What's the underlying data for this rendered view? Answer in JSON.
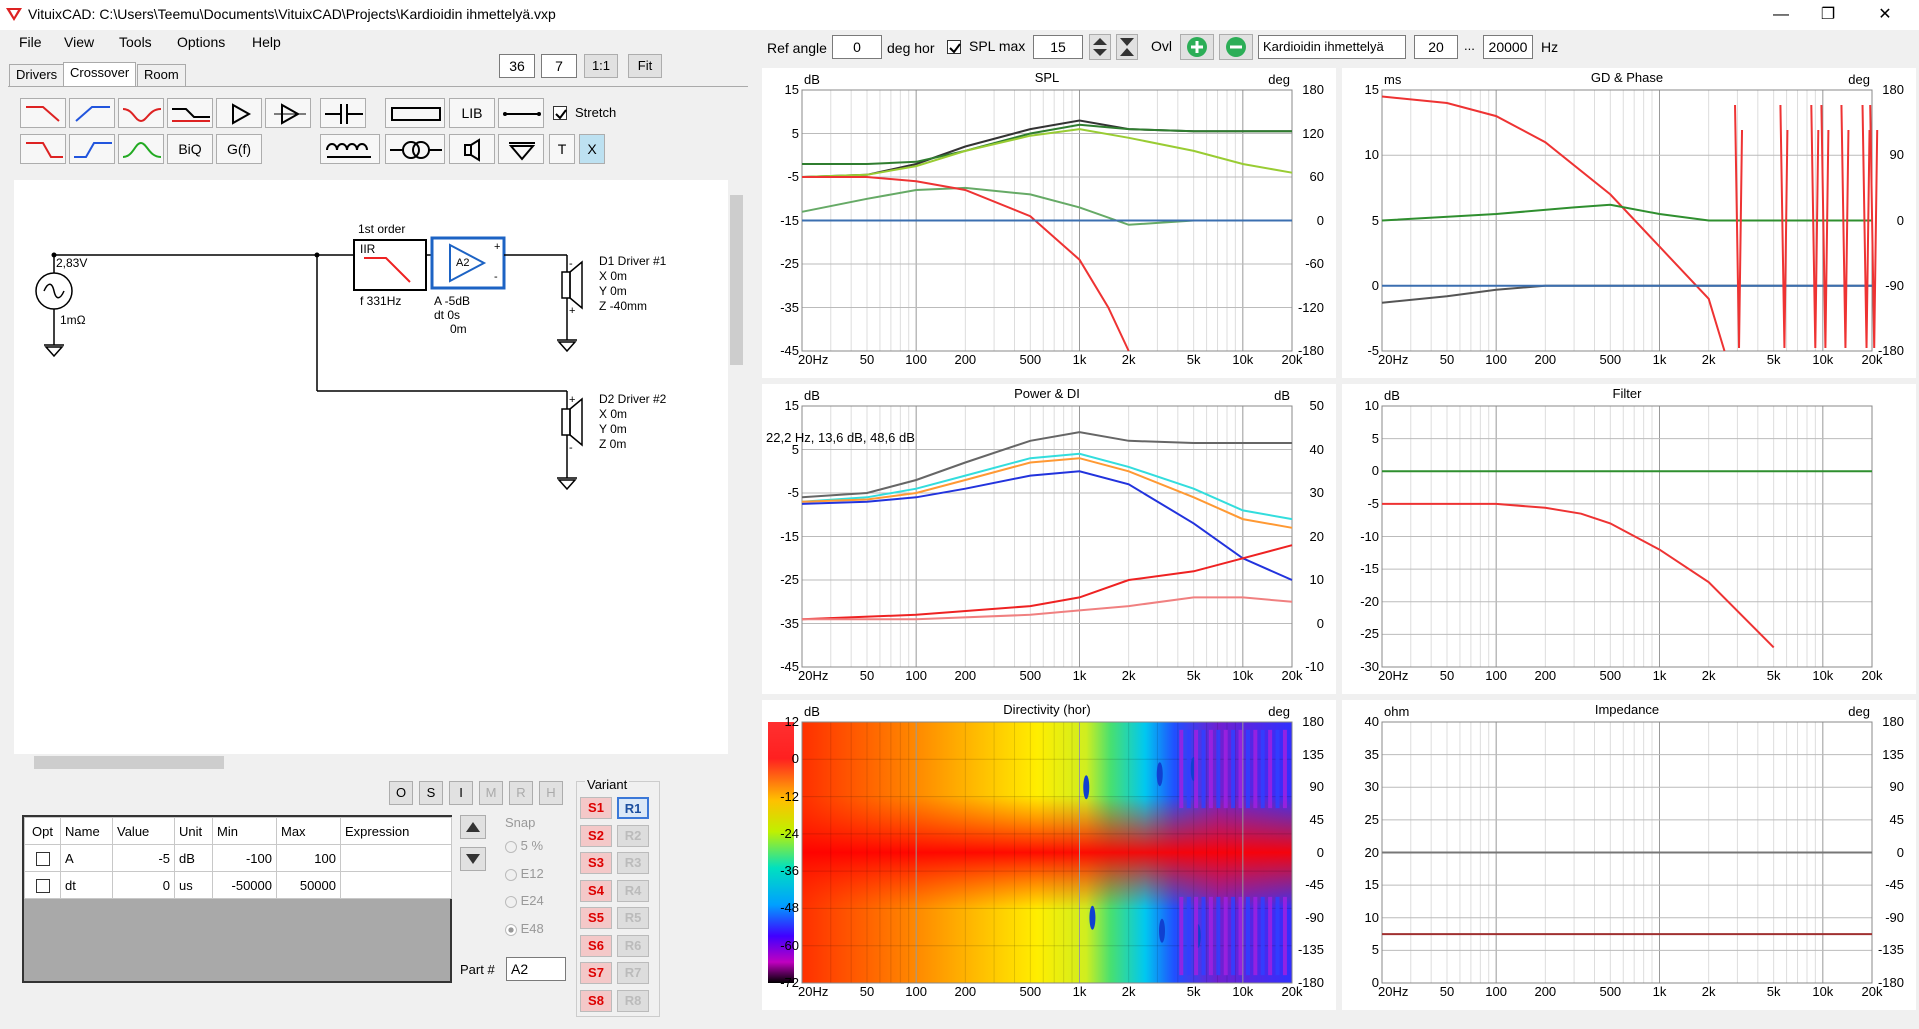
{
  "window": {
    "title": "VituixCAD: C:\\Users\\Teemu\\Documents\\VituixCAD\\Projects\\Kardioidin ihmettelyä.vxp",
    "minimize": "—",
    "restore": "❐",
    "close": "✕"
  },
  "menu": [
    "File",
    "View",
    "Tools",
    "Options",
    "Help"
  ],
  "tabs": [
    "Drivers",
    "Crossover",
    "Room"
  ],
  "top_controls": {
    "val1": "36",
    "val2": "7",
    "one_to_one": "1:1",
    "fit": "Fit"
  },
  "toolbar": {
    "lib": "LIB",
    "biq": "BiQ",
    "gf": "G(f)",
    "t": "T",
    "x": "X",
    "stretch_label": "Stretch"
  },
  "schematic": {
    "source_voltage": "2,83V",
    "source_impedance": "1mΩ",
    "iir_label": "1st order",
    "iir_text": "IIR",
    "iir_freq": "f  331Hz",
    "amp_name": "A2",
    "amp_params": [
      "A  -5dB",
      "dt 0s",
      "0m"
    ],
    "d1": [
      "D1 Driver #1",
      "X 0m",
      "Y 0m",
      "Z -40mm"
    ],
    "d2": [
      "D2 Driver #2",
      "X 0m",
      "Y 0m",
      "Z 0m"
    ]
  },
  "osi_buttons": [
    "O",
    "S",
    "I",
    "M",
    "R",
    "H"
  ],
  "param_table": {
    "headers": [
      "Opt",
      "Name",
      "Value",
      "Unit",
      "Min",
      "Max",
      "Expression"
    ],
    "rows": [
      {
        "name": "A",
        "value": "-5",
        "unit": "dB",
        "min": "-100",
        "max": "100",
        "expr": ""
      },
      {
        "name": "dt",
        "value": "0",
        "unit": "us",
        "min": "-50000",
        "max": "50000",
        "expr": ""
      }
    ]
  },
  "snap": {
    "label": "Snap",
    "options": [
      "5 %",
      "E12",
      "E24",
      "E48"
    ],
    "selected": "E48"
  },
  "part": {
    "label": "Part #",
    "value": "A2"
  },
  "variant": {
    "label": "Variant",
    "s": [
      "S1",
      "S2",
      "S3",
      "S4",
      "S5",
      "S6",
      "S7",
      "S8"
    ],
    "r": [
      "R1",
      "R2",
      "R3",
      "R4",
      "R5",
      "R6",
      "R7",
      "R8"
    ],
    "active": "R1"
  },
  "graph_controls": {
    "ref_angle_label": "Ref angle",
    "ref_angle": "0",
    "deg_hor": "deg hor",
    "spl_max_label": "SPL max",
    "spl_max": "15",
    "ovl": "Ovl",
    "name": "Kardioidin ihmettelyä",
    "f_min": "20",
    "dots": "...",
    "f_max": "20000",
    "hz": "Hz"
  },
  "freq_ticks": [
    "20Hz",
    "50",
    "100",
    "200",
    "500",
    "1k",
    "2k",
    "5k",
    "10k",
    "20k"
  ],
  "charts": {
    "spl": {
      "title": "SPL",
      "left_unit": "dB",
      "right_unit": "deg",
      "left": [
        "15",
        "5",
        "-5",
        "-15",
        "-25",
        "-35",
        "-45"
      ],
      "right": [
        "180",
        "120",
        "60",
        "0",
        "-60",
        "-120",
        "-180"
      ]
    },
    "gd": {
      "title": "GD & Phase",
      "left_unit": "ms",
      "right_unit": "deg",
      "left": [
        "15",
        "10",
        "5",
        "0",
        "-5"
      ],
      "right": [
        "180",
        "90",
        "0",
        "-90",
        "-180"
      ]
    },
    "power": {
      "title": "Power & DI",
      "left_unit": "dB",
      "right_unit": "dB",
      "left": [
        "15",
        "5",
        "-5",
        "-15",
        "-25",
        "-35",
        "-45"
      ],
      "right": [
        "50",
        "40",
        "30",
        "20",
        "10",
        "0",
        "-10"
      ],
      "readout": "22,2 Hz, 13,6 dB, 48,6 dB"
    },
    "filter": {
      "title": "Filter",
      "left_unit": "dB",
      "left": [
        "10",
        "5",
        "0",
        "-5",
        "-10",
        "-15",
        "-20",
        "-25",
        "-30"
      ]
    },
    "directivity": {
      "title": "Directivity (hor)",
      "left_unit": "dB",
      "right_unit": "deg",
      "left": [
        "12",
        "0",
        "-12",
        "-24",
        "-36",
        "-48",
        "-60",
        "-72"
      ],
      "right": [
        "180",
        "135",
        "90",
        "45",
        "0",
        "-45",
        "-90",
        "-135",
        "-180"
      ]
    },
    "impedance": {
      "title": "Impedance",
      "left_unit": "ohm",
      "right_unit": "deg",
      "left": [
        "40",
        "35",
        "30",
        "25",
        "20",
        "15",
        "10",
        "5",
        "0"
      ],
      "right": [
        "180",
        "135",
        "90",
        "45",
        "0",
        "-45",
        "-90",
        "-135",
        "-180"
      ]
    }
  },
  "chart_data": [
    {
      "type": "line",
      "title": "SPL",
      "xscale": "log",
      "xlim": [
        20,
        20000
      ],
      "ylim": [
        -45,
        15
      ],
      "y2lim": [
        -180,
        180
      ],
      "series": [
        {
          "color": "#333333",
          "x": [
            20,
            50,
            100,
            200,
            500,
            1000,
            2000,
            5000,
            10000,
            20000
          ],
          "y": [
            -5,
            -4.5,
            -2,
            2,
            6,
            8,
            6,
            5.5,
            5.5,
            5.5
          ]
        },
        {
          "color": "#2f7d2f",
          "x": [
            20,
            50,
            100,
            200,
            500,
            1000,
            2000,
            5000,
            10000,
            20000
          ],
          "y": [
            -2,
            -2,
            -1.5,
            1,
            5,
            7,
            6,
            5.5,
            5.5,
            5.5
          ]
        },
        {
          "color": "#99cc33",
          "x": [
            20,
            50,
            100,
            200,
            500,
            1000,
            2000,
            5000,
            10000,
            20000
          ],
          "y": [
            -5,
            -4.5,
            -2.5,
            1,
            4.5,
            6,
            4,
            1,
            -2,
            -4
          ]
        },
        {
          "color": "#66aa66",
          "x": [
            20,
            50,
            100,
            200,
            500,
            1000,
            2000,
            5000,
            10000,
            20000
          ],
          "y": [
            -13,
            -10,
            -8,
            -7.5,
            -9,
            -12,
            -16,
            -15,
            -15,
            -15
          ]
        },
        {
          "color": "#ee3333",
          "x": [
            20,
            50,
            100,
            200,
            500,
            1000,
            1500,
            2000
          ],
          "y": [
            -5,
            -5,
            -6,
            -8,
            -14,
            -24,
            -35,
            -45
          ]
        },
        {
          "color": "#3b6fb0",
          "x": [
            20,
            20000
          ],
          "y": [
            -15,
            -15
          ]
        }
      ]
    },
    {
      "type": "line",
      "title": "GD & Phase",
      "xscale": "log",
      "xlim": [
        20,
        20000
      ],
      "ylim": [
        -5,
        15
      ],
      "y2lim": [
        -180,
        180
      ],
      "series": [
        {
          "color": "#ee3333",
          "x": [
            20,
            50,
            100,
            200,
            500,
            1000,
            2000,
            2500
          ],
          "y": [
            14.5,
            14,
            13,
            11,
            7,
            3,
            -1,
            -5
          ]
        },
        {
          "color": "#2f8f2f",
          "x": [
            20,
            100,
            300,
            500,
            1000,
            2000,
            5000,
            20000
          ],
          "y": [
            5,
            5.5,
            6,
            6.2,
            5.5,
            5,
            5,
            5
          ]
        },
        {
          "color": "#555555",
          "x": [
            20,
            50,
            100,
            200,
            500,
            20000
          ],
          "y": [
            -1.3,
            -0.8,
            -0.3,
            0,
            0,
            0
          ]
        },
        {
          "color": "#3b6fb0",
          "x": [
            20,
            20000
          ],
          "y": [
            0,
            0
          ]
        }
      ]
    },
    {
      "type": "line",
      "title": "Power & DI",
      "xscale": "log",
      "xlim": [
        20,
        20000
      ],
      "ylim": [
        -45,
        15
      ],
      "y2lim": [
        -10,
        50
      ],
      "series": [
        {
          "color": "#666666",
          "x": [
            20,
            50,
            100,
            200,
            500,
            1000,
            2000,
            5000,
            20000
          ],
          "y": [
            -6,
            -5,
            -2,
            2,
            7,
            9,
            7,
            6.5,
            6.5
          ]
        },
        {
          "color": "#33dddd",
          "x": [
            20,
            50,
            100,
            200,
            500,
            1000,
            2000,
            5000,
            10000,
            20000
          ],
          "y": [
            -7,
            -6,
            -4,
            -1,
            3,
            4,
            1,
            -4,
            -9,
            -11
          ]
        },
        {
          "color": "#ff9933",
          "x": [
            20,
            50,
            100,
            200,
            500,
            1000,
            2000,
            5000,
            10000,
            20000
          ],
          "y": [
            -7,
            -6.5,
            -5,
            -2,
            2,
            3,
            0,
            -6,
            -11,
            -13
          ]
        },
        {
          "color": "#2233dd",
          "x": [
            20,
            50,
            100,
            200,
            500,
            1000,
            2000,
            5000,
            10000,
            20000
          ],
          "y": [
            -7.5,
            -7,
            -6,
            -4,
            -1,
            0,
            -3,
            -12,
            -20,
            -25
          ]
        },
        {
          "color": "#ee2222",
          "x": [
            20,
            100,
            500,
            1000,
            2000,
            5000,
            10000,
            20000
          ],
          "y": [
            -34,
            -33,
            -31,
            -29,
            -25,
            -23,
            -20,
            -17
          ]
        },
        {
          "color": "#f08080",
          "x": [
            20,
            100,
            500,
            1000,
            2000,
            5000,
            10000,
            20000
          ],
          "y": [
            -34,
            -34,
            -33,
            -32,
            -31,
            -29,
            -29,
            -30
          ]
        }
      ]
    },
    {
      "type": "line",
      "title": "Filter",
      "xscale": "log",
      "xlim": [
        20,
        20000
      ],
      "ylim": [
        -30,
        10
      ],
      "series": [
        {
          "color": "#2f8f2f",
          "x": [
            20,
            20000
          ],
          "y": [
            0,
            0
          ]
        },
        {
          "color": "#ee3333",
          "x": [
            20,
            100,
            200,
            331,
            500,
            1000,
            2000,
            5000
          ],
          "y": [
            -5,
            -5,
            -5.6,
            -6.5,
            -8,
            -12,
            -17,
            -27
          ]
        }
      ]
    },
    {
      "type": "heatmap",
      "title": "Directivity (hor)",
      "xscale": "log",
      "xlim": [
        20,
        20000
      ],
      "ylim": [
        -180,
        180
      ],
      "zlim": [
        -72,
        12
      ]
    },
    {
      "type": "line",
      "title": "Impedance",
      "xscale": "log",
      "xlim": [
        20,
        20000
      ],
      "ylim": [
        0,
        40
      ],
      "y2lim": [
        -180,
        180
      ],
      "series": [
        {
          "color": "#a03030",
          "x": [
            20,
            20000
          ],
          "y": [
            7.5,
            7.5
          ]
        },
        {
          "color": "#777777",
          "x": [
            20,
            20000
          ],
          "y": [
            20,
            20
          ]
        }
      ]
    }
  ]
}
